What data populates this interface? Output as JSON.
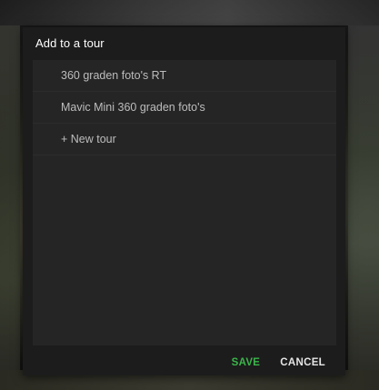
{
  "dialog": {
    "title": "Add to a tour",
    "tours": [
      {
        "label": "360 graden foto's RT"
      },
      {
        "label": "Mavic Mini 360 graden foto's"
      }
    ],
    "new_tour_label": "+ New tour",
    "save_label": "SAVE",
    "cancel_label": "CANCEL"
  },
  "colors": {
    "dialog_bg": "#1c1c1c",
    "list_bg": "#252525",
    "save_accent": "#3bb54a",
    "text_primary": "#ffffff",
    "text_secondary": "#bdbdbd"
  }
}
